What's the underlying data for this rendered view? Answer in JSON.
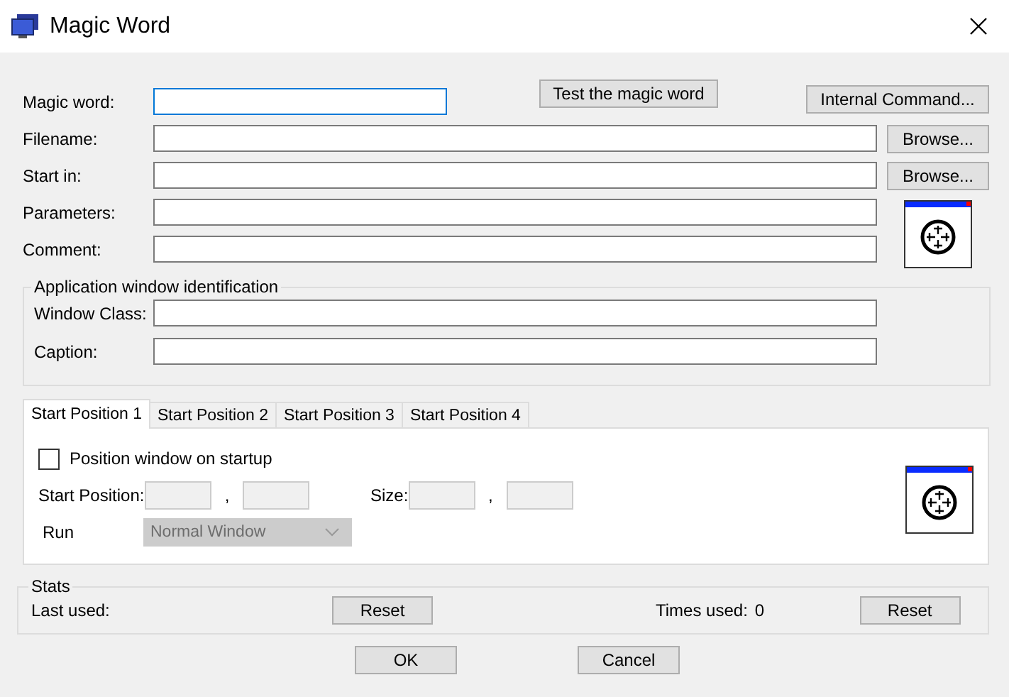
{
  "window": {
    "title": "Magic Word"
  },
  "magic_word": {
    "label": "Magic word:",
    "focused": true
  },
  "test_button": "Test the magic word",
  "internal_command_button": "Internal Command...",
  "fields": [
    {
      "label": "Filename:",
      "browse": "Browse..."
    },
    {
      "label": "Start in:",
      "browse": "Browse..."
    },
    {
      "label": "Parameters:"
    },
    {
      "label": "Comment:"
    }
  ],
  "identification": {
    "title": "Application window identification",
    "fields": [
      {
        "label": "Window Class:"
      },
      {
        "label": "Caption:"
      }
    ]
  },
  "tabs": [
    {
      "label": "Start Position 1",
      "selected": true
    },
    {
      "label": "Start Position 2",
      "selected": false
    },
    {
      "label": "Start Position 3",
      "selected": false
    },
    {
      "label": "Start Position 4",
      "selected": false
    }
  ],
  "position_checkbox": {
    "label": "Position window on startup",
    "checked": false
  },
  "start_position": {
    "label": "Start Position:",
    "separator": ",",
    "disabled": true
  },
  "size": {
    "label": "Size:",
    "separator": ",",
    "disabled": true
  },
  "run": {
    "label": "Run",
    "value": "Normal Window",
    "disabled": true
  },
  "stats": {
    "title": "Stats",
    "last_used": "Last used:",
    "reset": "Reset",
    "times_used": "Times used:",
    "times_value": "0",
    "reset_times": "Reset"
  },
  "footer": {
    "ok": "OK",
    "cancel": "Cancel"
  }
}
